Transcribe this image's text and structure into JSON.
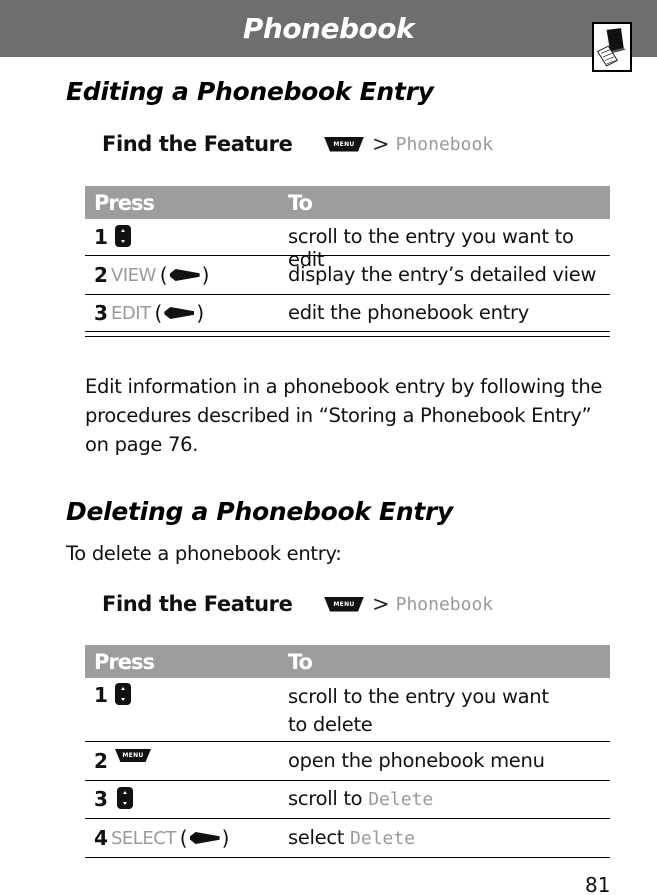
{
  "header": {
    "title": "Phonebook",
    "chapter_icon": "phone-book-icon"
  },
  "section1": {
    "heading": "Editing a Phonebook Entry",
    "find_feature": {
      "label": "Find the Feature",
      "menu_key": "MENU",
      "separator": ">",
      "path": "Phonebook"
    },
    "table": {
      "columns": [
        "Press",
        "To"
      ],
      "rows": [
        {
          "num": "1",
          "press_icon": "nav-key-icon",
          "press_label": "",
          "to": "scroll to the entry you want to edit"
        },
        {
          "num": "2",
          "press_label": "VIEW",
          "press_icon": "soft-key-icon",
          "to": "display the entry’s detailed view"
        },
        {
          "num": "3",
          "press_label": "EDIT",
          "press_icon": "soft-key-icon",
          "to": "edit the phonebook entry"
        }
      ]
    },
    "body": "Edit information in a phonebook entry by following the procedures described in “Storing a Phonebook Entry” on page 76."
  },
  "section2": {
    "heading": "Deleting a Phonebook Entry",
    "intro": "To delete a phonebook entry:",
    "find_feature": {
      "label": "Find the Feature",
      "menu_key": "MENU",
      "separator": ">",
      "path": "Phonebook"
    },
    "table": {
      "columns": [
        "Press",
        "To"
      ],
      "rows": [
        {
          "num": "1",
          "press_icon": "nav-key-icon",
          "to": "scroll to the entry you want to delete"
        },
        {
          "num": "2",
          "press_icon": "menu-key-icon",
          "press_label": "MENU",
          "to": "open the phonebook menu"
        },
        {
          "num": "3",
          "press_icon": "nav-key-icon",
          "to_prefix": "scroll to",
          "to_display": "Delete"
        },
        {
          "num": "4",
          "press_label": "SELECT",
          "press_icon": "soft-key-icon",
          "to_prefix": "select",
          "to_display": "Delete"
        }
      ]
    }
  },
  "footer": {
    "page_number": "81"
  }
}
